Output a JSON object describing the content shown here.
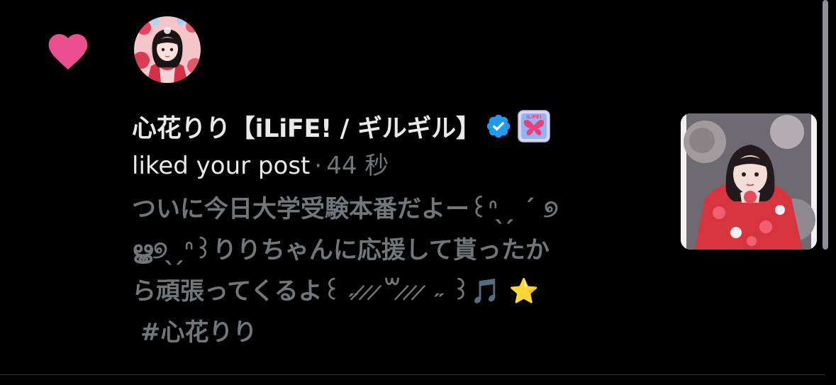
{
  "notification": {
    "type": "like",
    "user": {
      "display_name": "心花りり【iLiFE! / ギルギル】",
      "verified": true,
      "verified_icon": "verified-check-icon",
      "badge_icon": "ilife-affiliate-badge",
      "badge_text": "iLiFE!"
    },
    "action_text": "liked your post",
    "separator": "·",
    "time": "44 秒",
    "post": {
      "text": "ついに今日大学受験本番だよー꒰ᐢ ̖ ̗ ´ ୭\n ൠ୭ ̖ ̗ᐢ꒱りりちゃんに応援して貰ったか\nら頑張ってくるよ꒰ ˶ ̷ ̷ ̷꒳ ̷ ̷ ̷ ˶ ꒱🎵 ⭐",
      "hashtag": "#心花りり"
    }
  },
  "colors": {
    "background": "#000000",
    "heart": "#f91880",
    "verified": "#1d9bf0",
    "primary_text": "#e7e9ea",
    "secondary_text": "#71767b"
  }
}
